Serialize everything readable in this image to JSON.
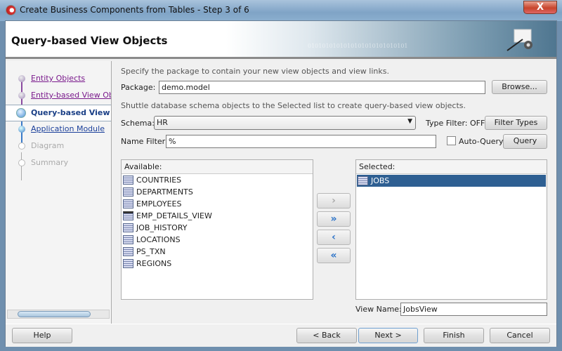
{
  "window": {
    "title": "Create Business Components from Tables - Step 3 of 6",
    "close_label": "X"
  },
  "header": {
    "title": "Query-based View Objects",
    "banner_text": "0101010101010101010101010101"
  },
  "nav": {
    "items": [
      {
        "label": "Entity Objects",
        "state": "visited"
      },
      {
        "label": "Entity-based View Objects",
        "state": "visited"
      },
      {
        "label": "Query-based View Objects",
        "state": "current"
      },
      {
        "label": "Application Module",
        "state": "next"
      },
      {
        "label": "Diagram",
        "state": "future"
      },
      {
        "label": "Summary",
        "state": "future"
      }
    ]
  },
  "main": {
    "package_hint": "Specify the package to contain your new view objects and view links.",
    "package_label": "Package:",
    "package_value": "demo.model",
    "browse_label": "Browse...",
    "shuttle_hint": "Shuttle database schema objects to the Selected list to create query-based view objects.",
    "schema_label": "Schema:",
    "schema_value": "HR",
    "type_filter_status": "Type Filter: OFF",
    "filter_types_label": "Filter Types",
    "name_filter_label": "Name Filter:",
    "name_filter_value": "%",
    "auto_query_label": "Auto-Query",
    "auto_query_checked": false,
    "query_label": "Query",
    "available_label": "Available:",
    "available": [
      {
        "name": "COUNTRIES",
        "icon": "table-icon"
      },
      {
        "name": "DEPARTMENTS",
        "icon": "table-icon"
      },
      {
        "name": "EMPLOYEES",
        "icon": "table-icon"
      },
      {
        "name": "EMP_DETAILS_VIEW",
        "icon": "view-icon"
      },
      {
        "name": "JOB_HISTORY",
        "icon": "table-icon"
      },
      {
        "name": "LOCATIONS",
        "icon": "table-icon"
      },
      {
        "name": "PS_TXN",
        "icon": "table-icon"
      },
      {
        "name": "REGIONS",
        "icon": "table-icon"
      }
    ],
    "selected_label": "Selected:",
    "selected": [
      {
        "name": "JOBS",
        "icon": "table-icon"
      }
    ],
    "shuttle": {
      "move": "›",
      "move_all": "»",
      "remove": "‹",
      "remove_all": "«"
    },
    "view_name_label": "View Name:",
    "view_name_value": "JobsView"
  },
  "footer": {
    "help": "Help",
    "back": "< Back",
    "next": "Next >",
    "finish": "Finish",
    "cancel": "Cancel"
  },
  "colors": {
    "selection": "#2e5f92",
    "visited_link": "#7a1a8c",
    "current_step": "#1a3f86"
  }
}
